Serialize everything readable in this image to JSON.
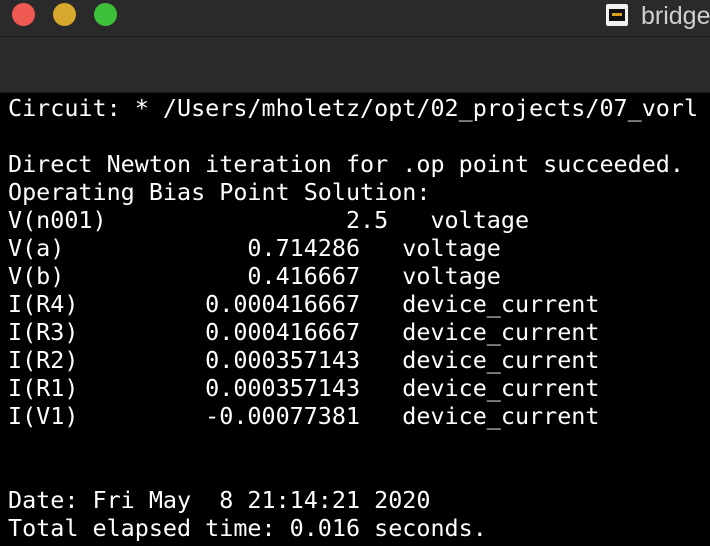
{
  "window": {
    "title": "bridge",
    "title_icon": "terminal-document-icon",
    "traffic_lights": {
      "close": "#ee5a52",
      "minimize": "#d7a82b",
      "zoom": "#3fc03a"
    }
  },
  "terminal": {
    "lines": [
      "Circuit: * /Users/mholetz/opt/02_projects/07_vorl",
      "",
      "Direct Newton iteration for .op point succeeded.",
      "Operating Bias Point Solution:",
      "V(n001)                 2.5   voltage",
      "V(a)             0.714286   voltage",
      "V(b)             0.416667   voltage",
      "I(R4)         0.000416667   device_current",
      "I(R3)         0.000416667   device_current",
      "I(R2)         0.000357143   device_current",
      "I(R1)         0.000357143   device_current",
      "I(V1)         -0.00077381   device_current",
      "",
      "",
      "Date: Fri May  8 21:14:21 2020",
      "Total elapsed time: 0.016 seconds."
    ]
  }
}
